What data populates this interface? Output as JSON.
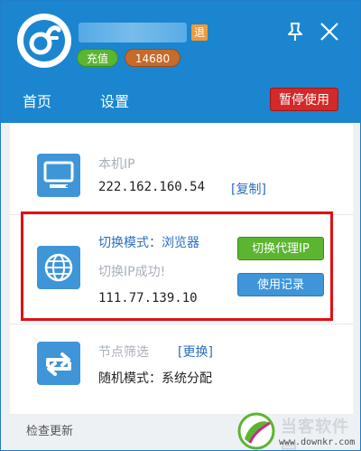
{
  "header": {
    "logout_label": "退",
    "recharge_label": "充值",
    "points": "14680",
    "tabs": [
      {
        "label": "首页",
        "active": true
      },
      {
        "label": "设置",
        "active": false
      }
    ],
    "pause_label": "暂停使用"
  },
  "local_ip": {
    "label": "本机IP",
    "value": "222.162.160.54",
    "copy_label": "[复制]"
  },
  "switch_section": {
    "mode_label": "切换模式：浏览器",
    "status_text": "切换IP成功!",
    "new_ip": "111.77.139.10",
    "switch_button": "切换代理IP",
    "history_button": "使用记录"
  },
  "node_section": {
    "label": "节点筛选",
    "change_label": "[更换]",
    "mode_text": "随机模式：系统分配"
  },
  "footer": {
    "check_update": "检查更新",
    "watermark_title": "当客软件园",
    "watermark_url": "www.downkr.com"
  },
  "colors": {
    "header_blue": "#1b86cf",
    "pause_red": "#d22929",
    "switch_green": "#5cb531",
    "highlight_red": "#e10f12",
    "link_blue": "#2a6fbe"
  },
  "icons": [
    "app-logo-icon",
    "pin-icon",
    "close-icon",
    "monitor-icon",
    "globe-icon",
    "refresh-arrows-icon"
  ]
}
